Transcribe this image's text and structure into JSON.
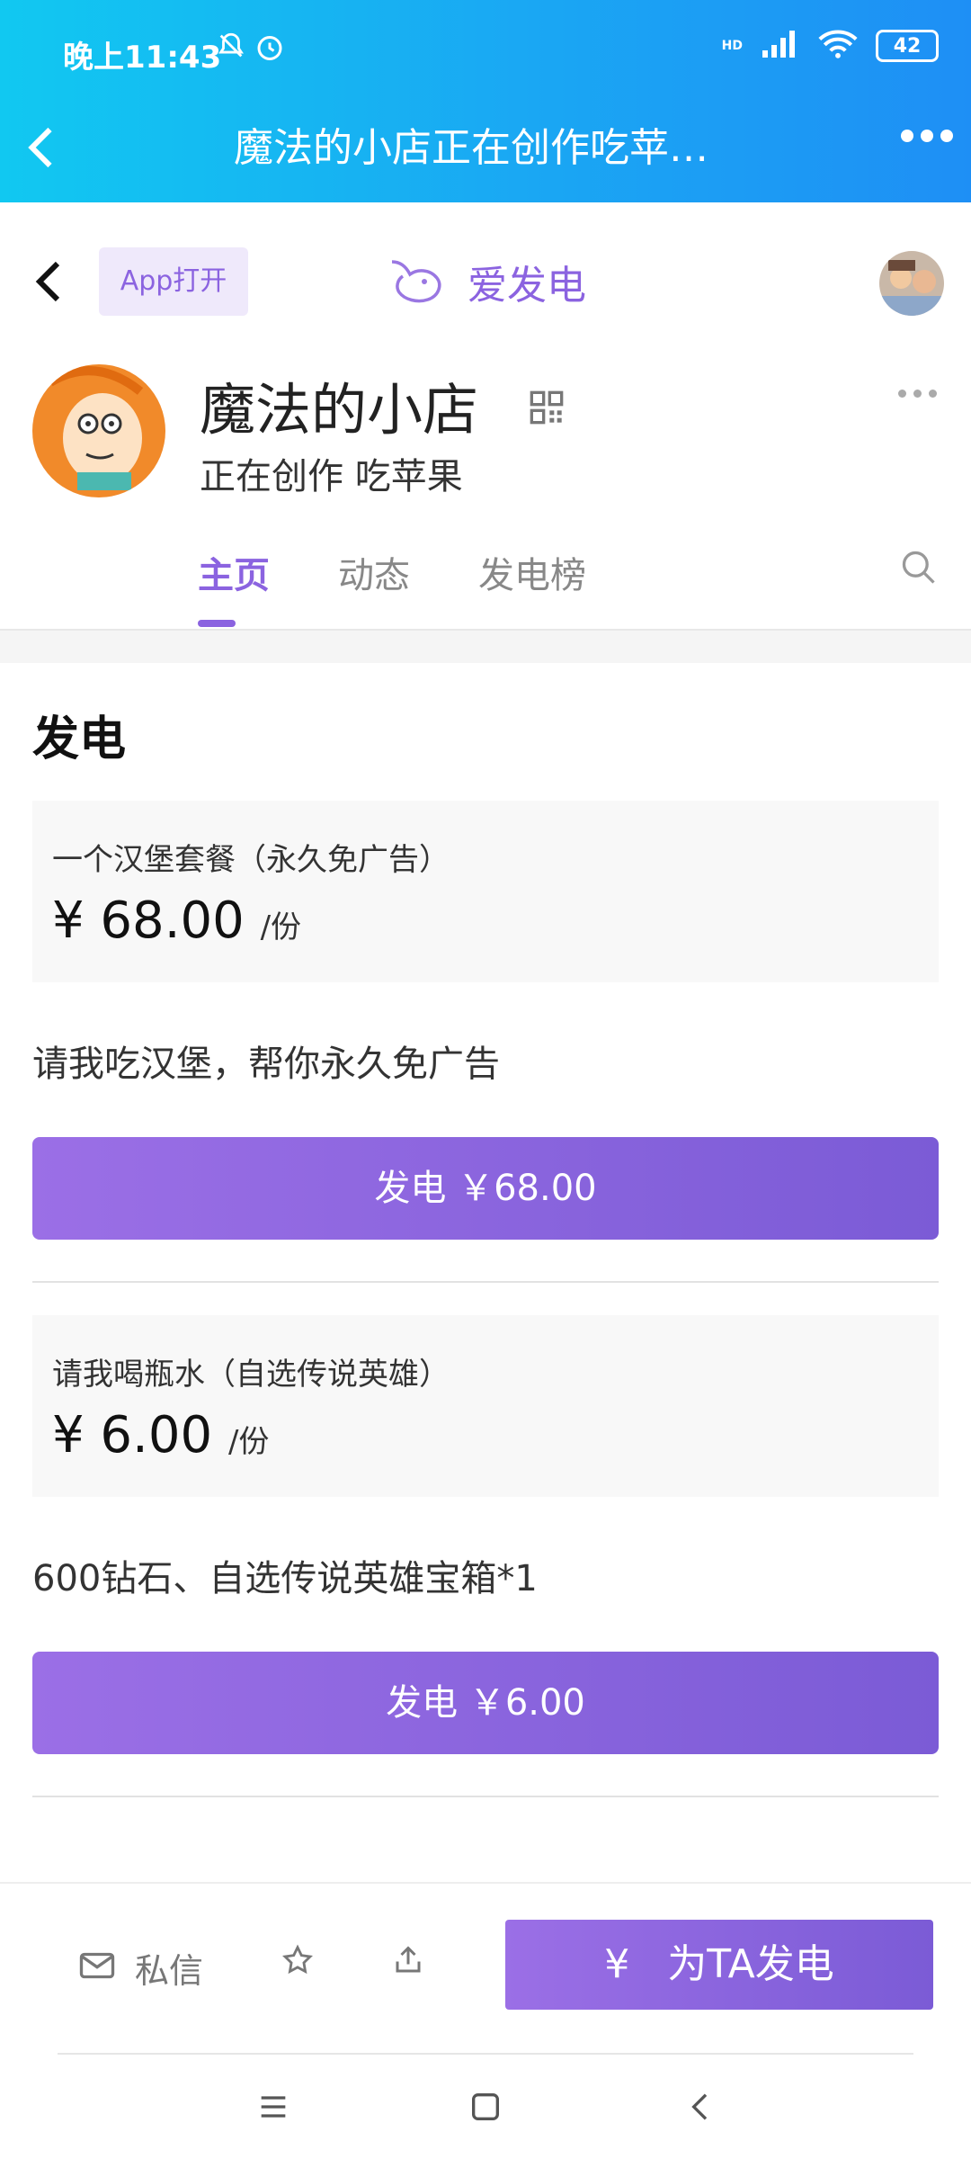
{
  "status_bar": {
    "time": "晚上11:43",
    "battery": "42",
    "network": "HD"
  },
  "title_bar": {
    "title": "魔法的小店正在创作吃苹…"
  },
  "top_nav": {
    "app_open_label": "App打开",
    "brand": "爱发电"
  },
  "profile": {
    "name": "魔法的小店",
    "subtitle": "正在创作 吃苹果"
  },
  "tabs": [
    {
      "label": "主页",
      "active": true
    },
    {
      "label": "动态",
      "active": false
    },
    {
      "label": "发电榜",
      "active": false
    }
  ],
  "section": {
    "title": "发电"
  },
  "plans": [
    {
      "name": "一个汉堡套餐（永久免广告）",
      "price": "¥ 68.00",
      "unit": "/份",
      "description": "请我吃汉堡，帮你永久免广告",
      "button": "发电 ￥68.00"
    },
    {
      "name": "请我喝瓶水（自选传说英雄）",
      "price": "¥ 6.00",
      "unit": "/份",
      "description": "600钻石、自选传说英雄宝箱*1",
      "button": "发电 ￥6.00"
    }
  ],
  "bottom_bar": {
    "message_label": "私信",
    "sponsor_label": "为TA发电",
    "sponsor_icon": "¥"
  },
  "colors": {
    "accent": "#8b63e0",
    "status_gradient_start": "#11c8f1",
    "status_gradient_end": "#1e8ff5"
  }
}
